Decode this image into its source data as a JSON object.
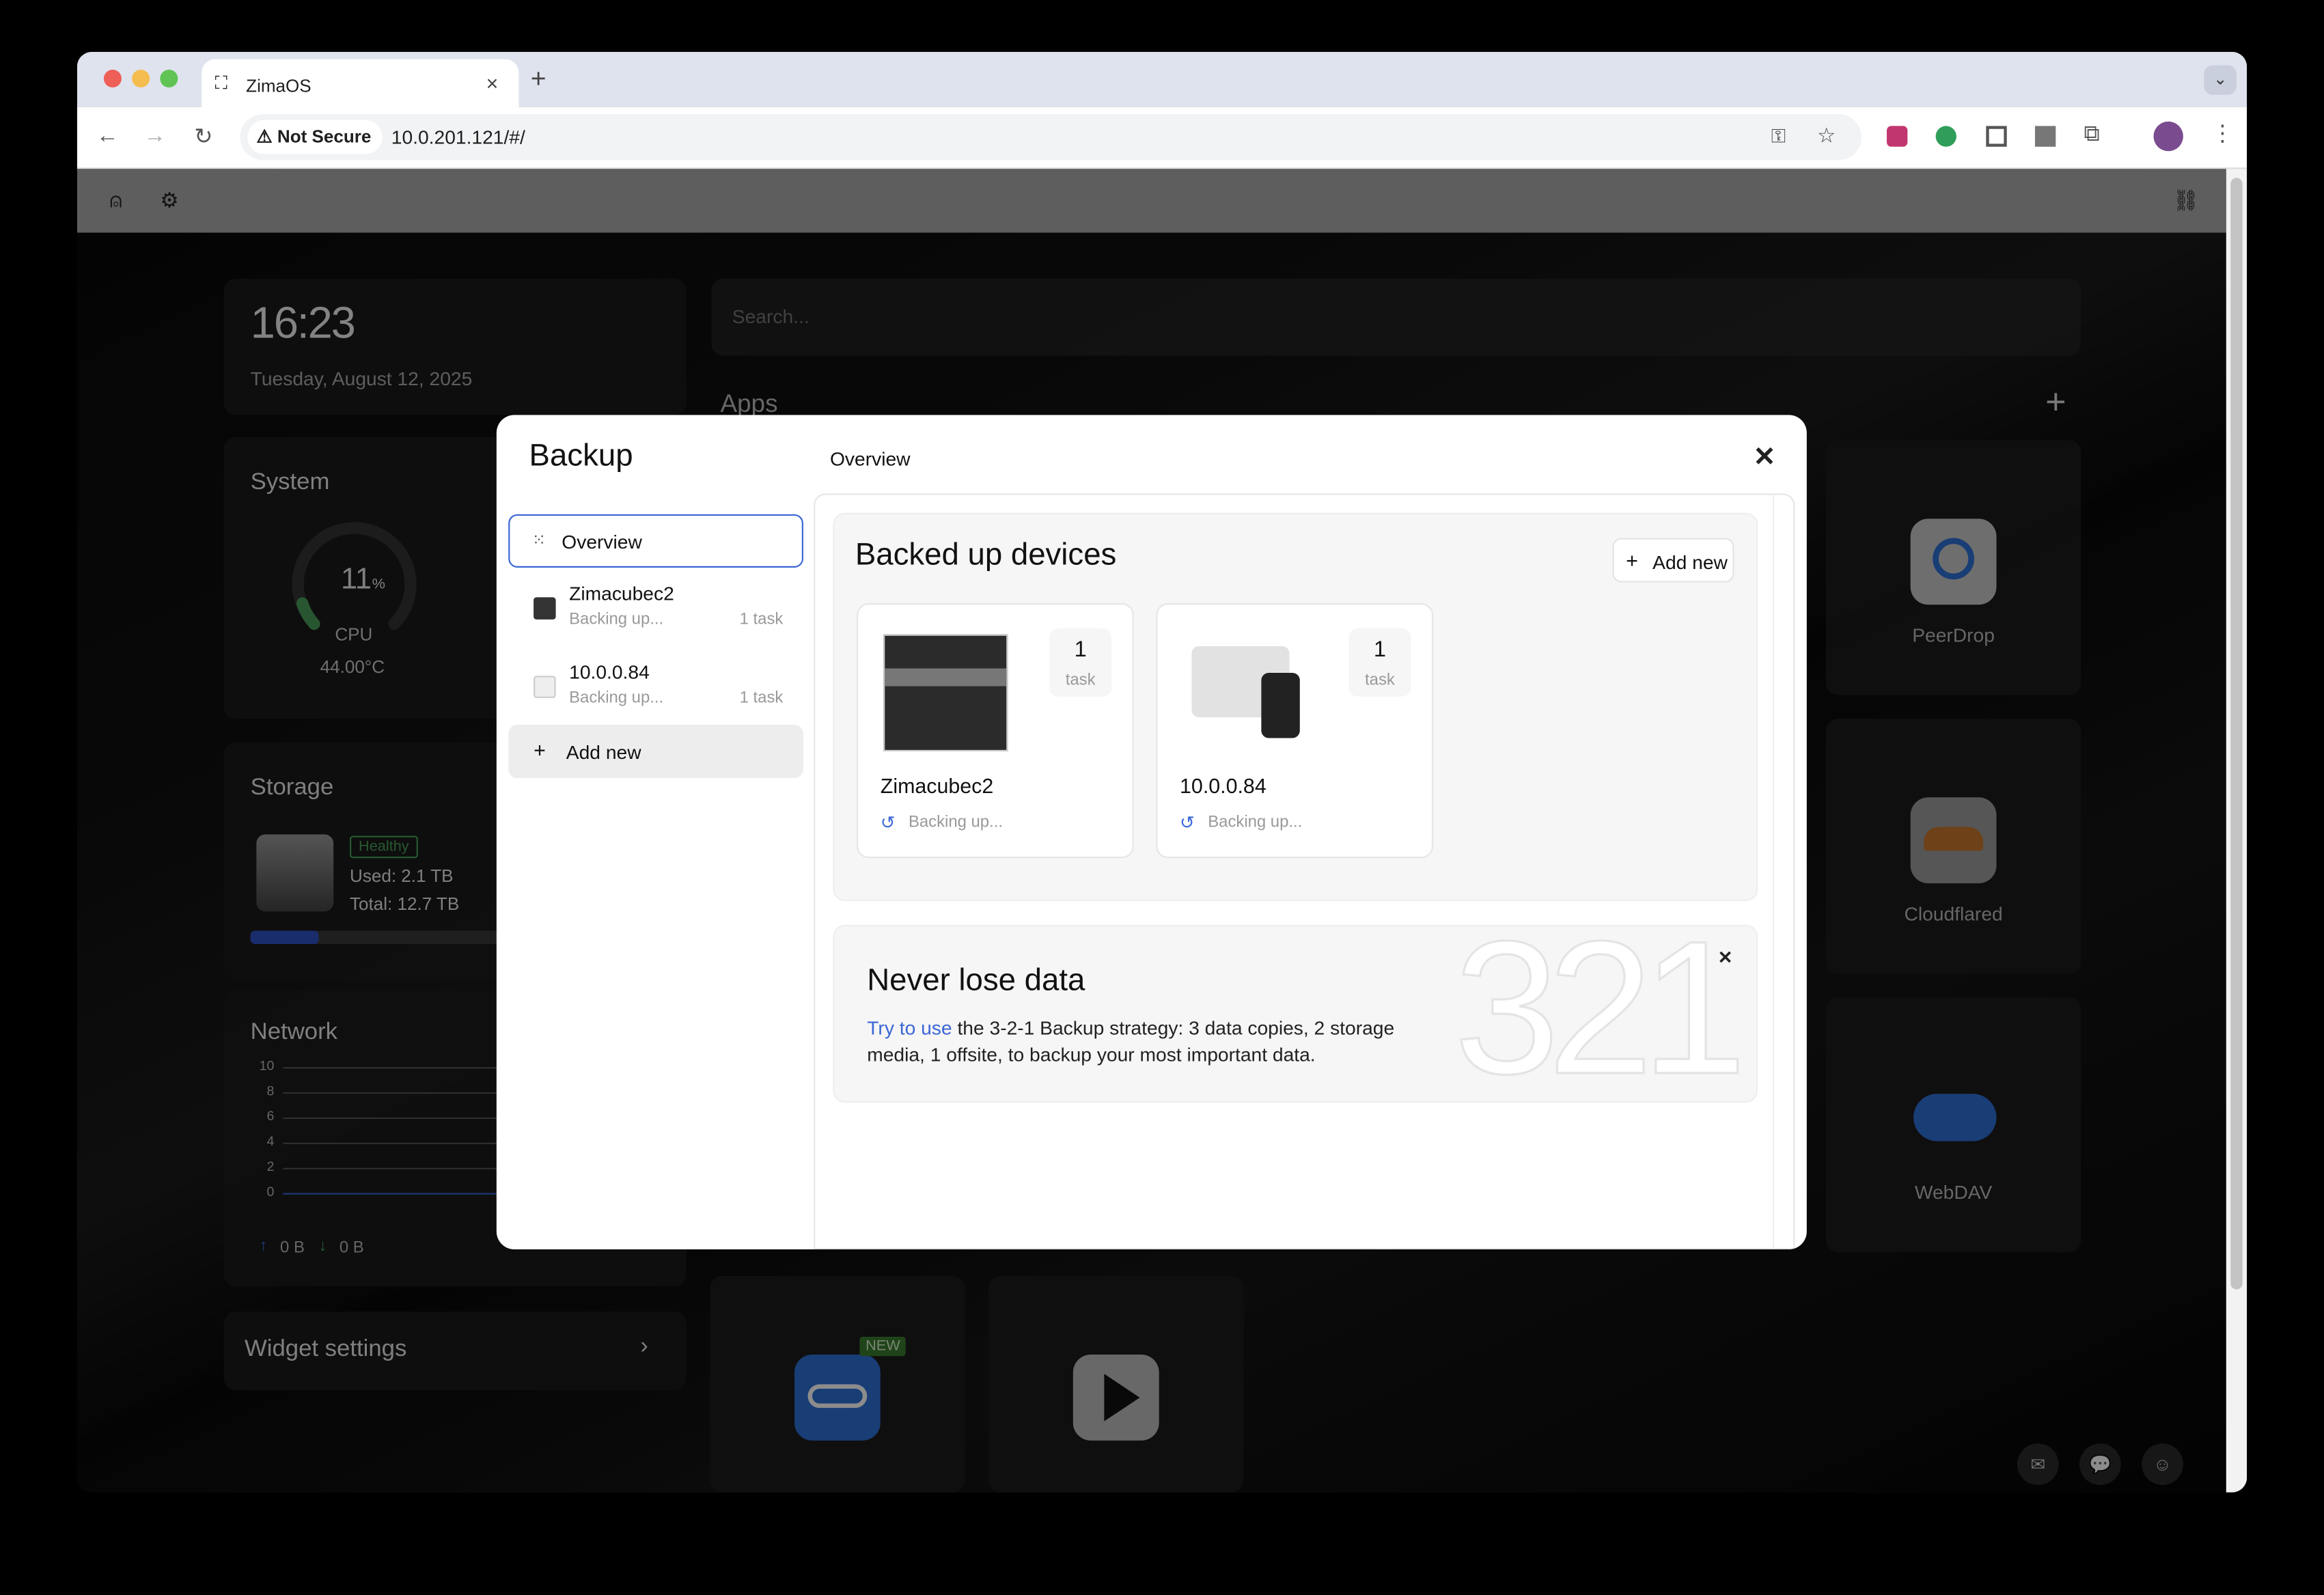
{
  "browser": {
    "tab_title": "ZimaOS",
    "tab_close": "×",
    "new_tab": "+",
    "security_label": "Not Secure",
    "url": "10.0.201.121/#/",
    "tab_menu": "⌄"
  },
  "dashboard": {
    "time": "16:23",
    "date": "Tuesday, August 12, 2025",
    "search_placeholder": "Search...",
    "apps_heading": "Apps",
    "add_app": "+",
    "system": {
      "title": "System",
      "cpu_percent": "11",
      "percent_sign": "%",
      "cpu_label": "CPU",
      "temperature": "44.00°C"
    },
    "storage": {
      "title": "Storage",
      "status": "Healthy",
      "used": "Used: 2.1 TB",
      "total": "Total: 12.7 TB",
      "used_fraction": 0.165
    },
    "network": {
      "title": "Network",
      "y_ticks": [
        "10",
        "8",
        "6",
        "4",
        "2",
        "0"
      ],
      "upload": "0 B",
      "download": "0 B"
    },
    "widget_settings": "Widget settings",
    "apps": [
      {
        "name": "PeerDrop"
      },
      {
        "name": "Cloudflared"
      },
      {
        "name": "WebDAV"
      }
    ],
    "new_badge": "NEW"
  },
  "modal": {
    "title": "Backup",
    "header": "Overview",
    "close": "✕",
    "sidebar": {
      "overview": "Overview",
      "items": [
        {
          "name": "Zimacubec2",
          "status": "Backing up...",
          "tasks": "1 task"
        },
        {
          "name": "10.0.0.84",
          "status": "Backing up...",
          "tasks": "1 task"
        }
      ],
      "add_new": "Add new"
    },
    "backed_up": {
      "title": "Backed up devices",
      "add_new": "Add new",
      "devices": [
        {
          "name": "Zimacubec2",
          "status": "Backing up...",
          "count": "1",
          "unit": "task"
        },
        {
          "name": "10.0.0.84",
          "status": "Backing up...",
          "count": "1",
          "unit": "task"
        }
      ]
    },
    "promo": {
      "title": "Never lose data",
      "link": "Try to use",
      "body": " the 3-2-1 Backup strategy: 3 data copies, 2 storage media, 1 offsite, to backup your most important data.",
      "close": "✕",
      "digits": "321"
    }
  }
}
